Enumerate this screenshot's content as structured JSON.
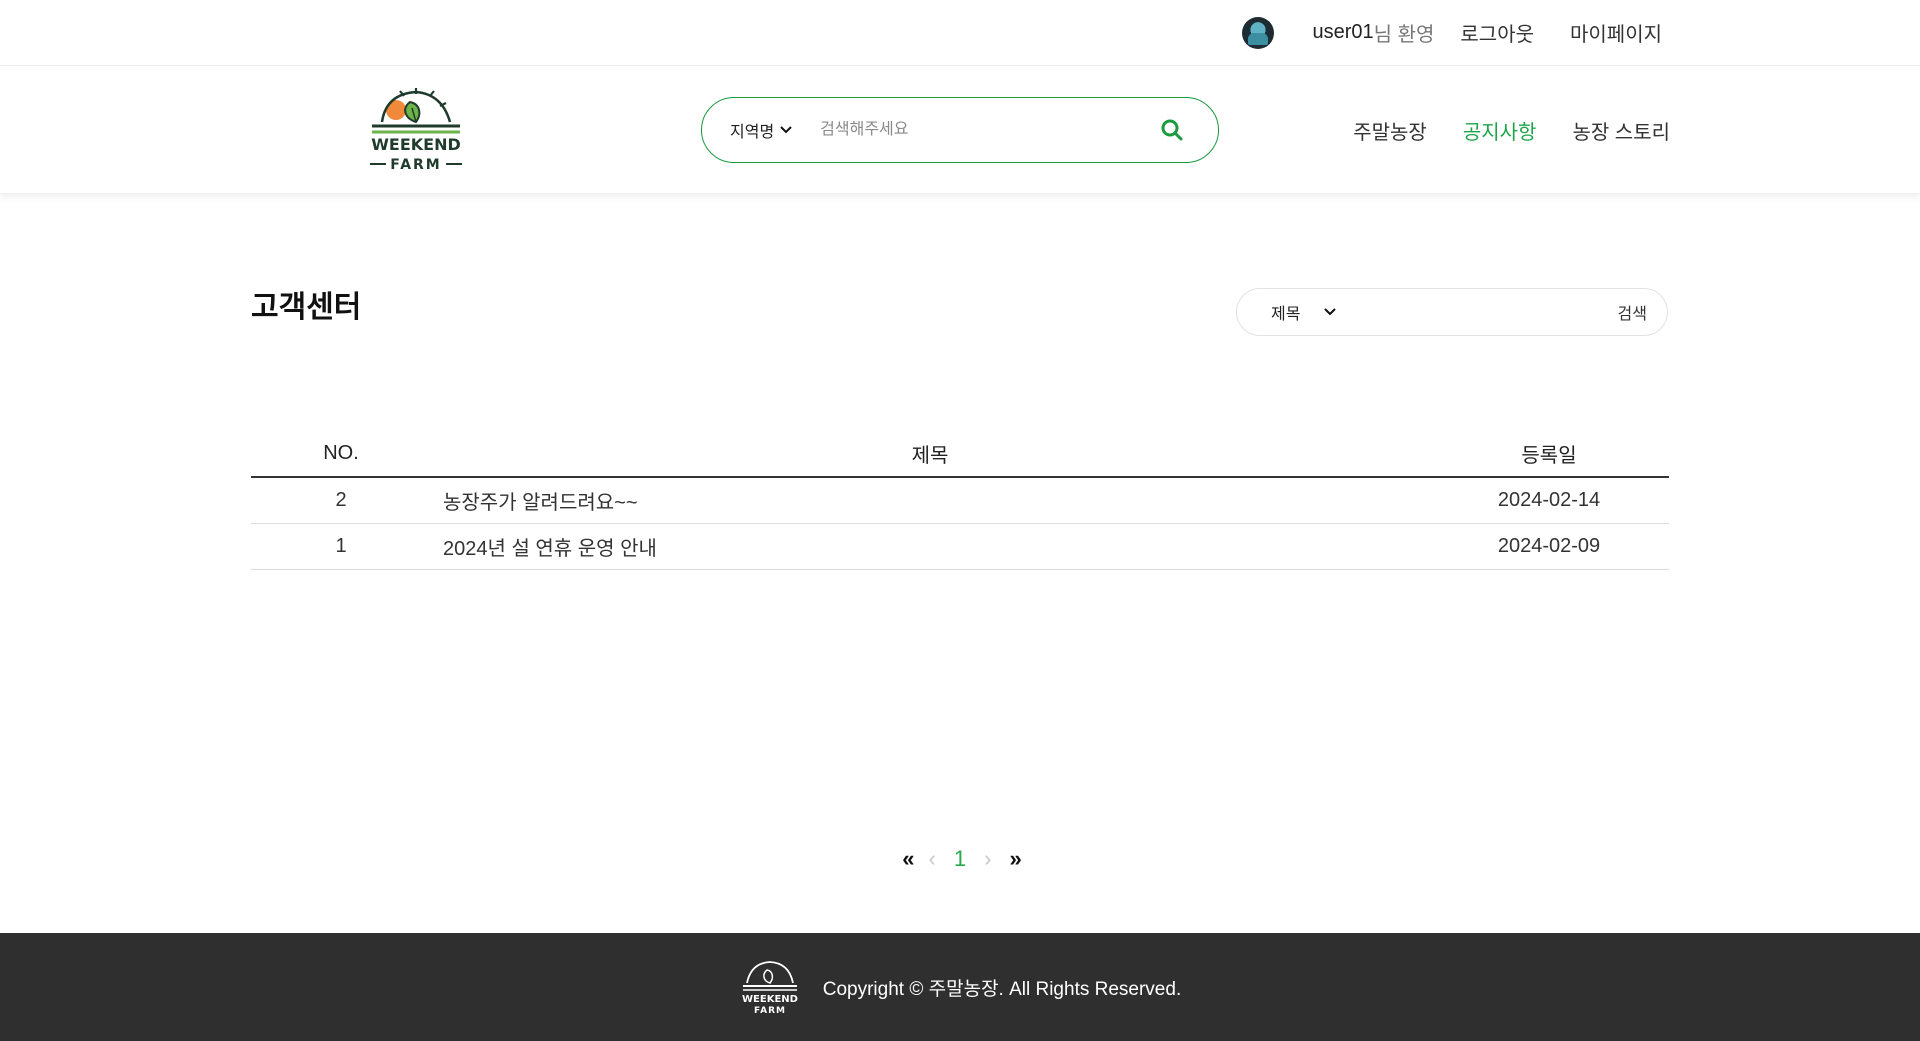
{
  "topbar": {
    "username": "user01",
    "welcome_suffix": "님 환영",
    "logout": "로그아웃",
    "mypage": "마이페이지"
  },
  "header": {
    "logo_text_top": "WEEKEND",
    "logo_text_bottom": "FARM",
    "region_label": "지역명",
    "search_placeholder": "검색해주세요",
    "nav": [
      "주말농장",
      "공지사항",
      "농장 스토리"
    ],
    "active_nav": "공지사항"
  },
  "main": {
    "title": "고객센터",
    "board_search": {
      "field_label": "제목",
      "button_label": "검색"
    },
    "table": {
      "headers": [
        "NO.",
        "제목",
        "등록일"
      ],
      "rows": [
        {
          "no": "2",
          "title": "농장주가 알려드려요~~",
          "date": "2024-02-14"
        },
        {
          "no": "1",
          "title": "2024년 설 연휴 운영 안내",
          "date": "2024-02-09"
        }
      ]
    },
    "pagination": {
      "first": "«",
      "prev": "‹",
      "current": "1",
      "next": "›",
      "last": "»"
    }
  },
  "footer": {
    "copyright": "Copyright © 주말농장. All Rights Reserved."
  },
  "colors": {
    "accent_green": "#1ea54a",
    "search_border": "#1b9a3f",
    "sun_orange": "#f08a3a",
    "footer_bg": "#2f2f2f"
  }
}
